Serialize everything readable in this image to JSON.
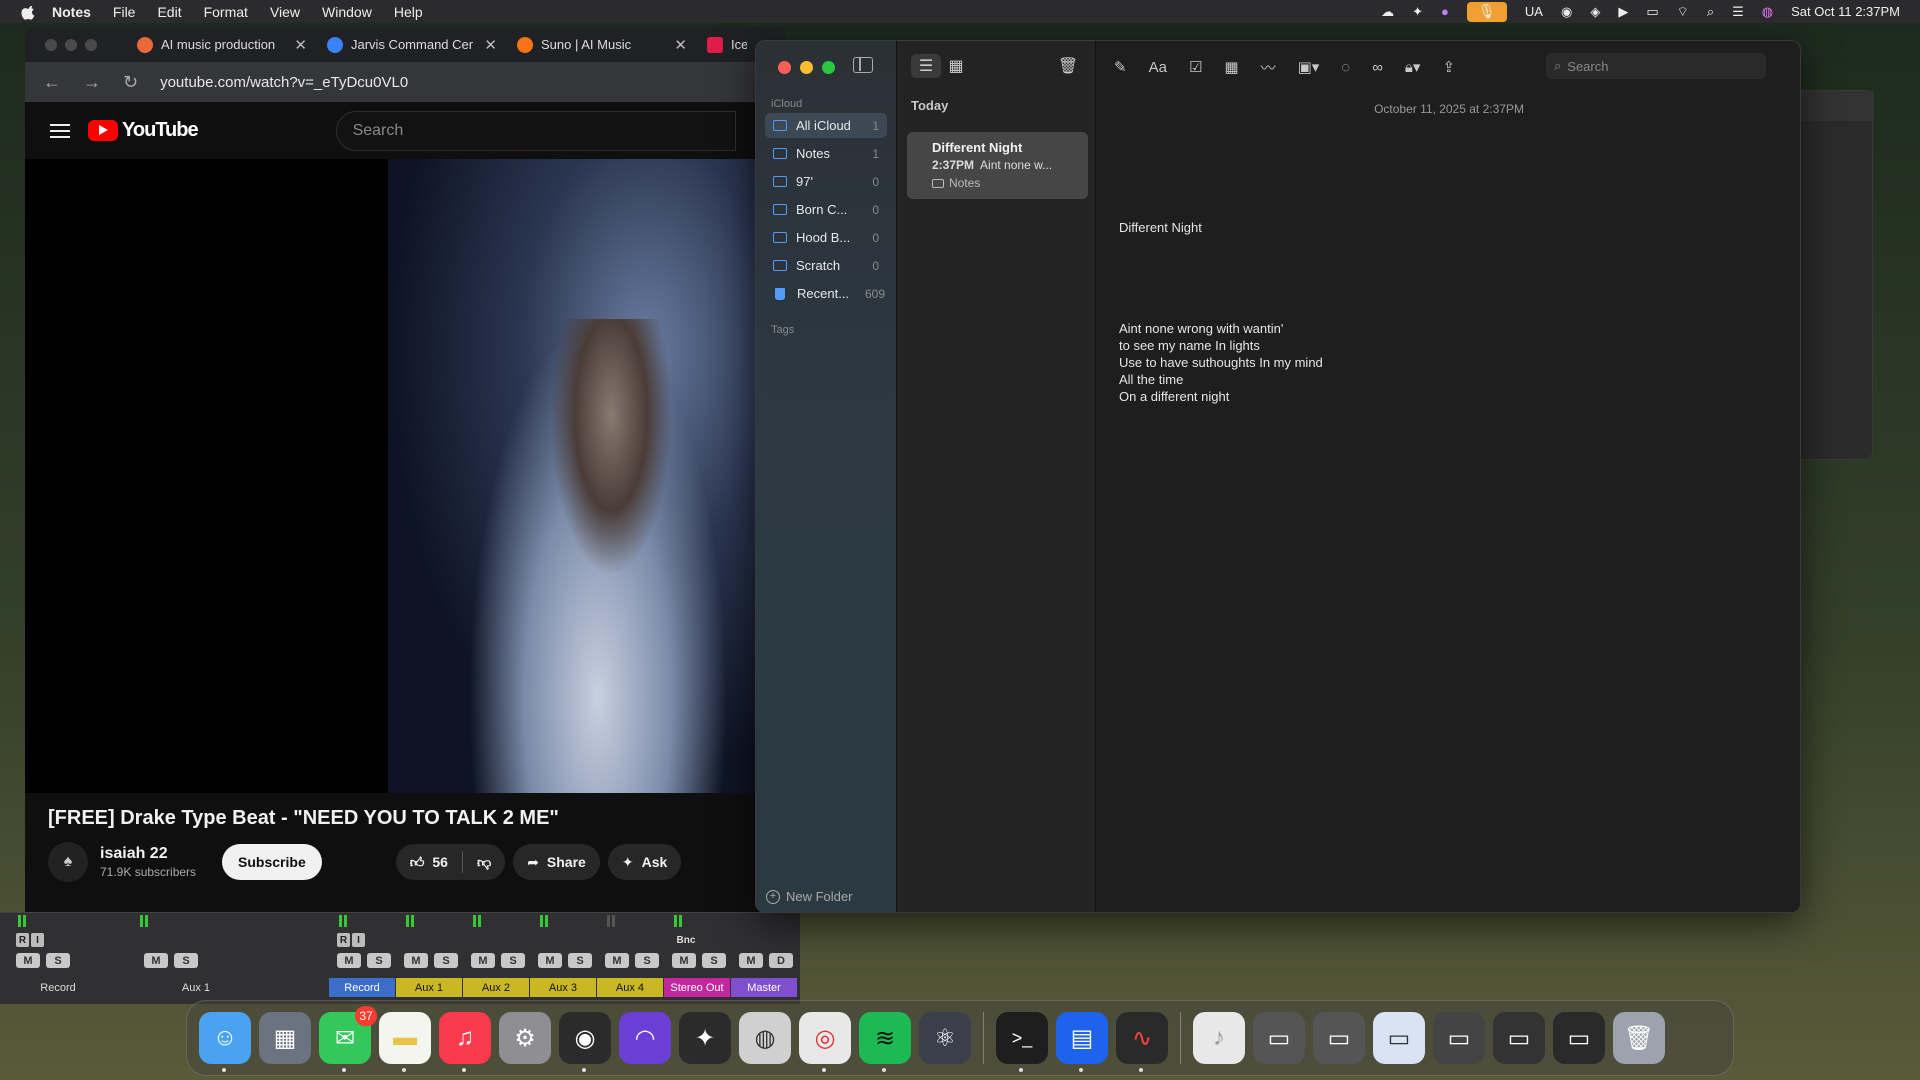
{
  "menubar": {
    "app": "Notes",
    "items": [
      "File",
      "Edit",
      "Format",
      "View",
      "Window",
      "Help"
    ],
    "keyboard_layout": "UA",
    "datetime": "Sat Oct 11  2:37PM"
  },
  "browser": {
    "tabs": [
      {
        "label": "AI music production",
        "favicon_color": "#e86a3a"
      },
      {
        "label": "Jarvis Command Cer",
        "favicon_color": "#3b82f6"
      },
      {
        "label": "Suno | AI Music",
        "favicon_color": "#f97316"
      },
      {
        "label": "Ice",
        "favicon_color": "#e11d48"
      }
    ],
    "url": "youtube.com/watch?v=_eTyDcu0VL0"
  },
  "youtube": {
    "logo_text": "YouTube",
    "search_placeholder": "Search",
    "video_title": "[FREE] Drake Type Beat - \"NEED YOU TO TALK 2 ME\"",
    "channel_name": "isaiah 22",
    "subscribers": "71.9K subscribers",
    "subscribe_label": "Subscribe",
    "likes": "56",
    "share_label": "Share",
    "ask_label": "Ask"
  },
  "mixer": {
    "left_channels": [
      {
        "name": "Record",
        "has_ri": true
      },
      {
        "name": "Aux 1",
        "has_ri": false
      }
    ],
    "channels": [
      {
        "name": "Record",
        "color": "#3a6ec8",
        "has_ri": true,
        "buttons": [
          "M",
          "S"
        ]
      },
      {
        "name": "Aux 1",
        "color": "#c9b823",
        "buttons": [
          "M",
          "S"
        ]
      },
      {
        "name": "Aux 2",
        "color": "#c9b823",
        "buttons": [
          "M",
          "S"
        ]
      },
      {
        "name": "Aux 3",
        "color": "#c9b823",
        "buttons": [
          "M",
          "S"
        ]
      },
      {
        "name": "Aux 4",
        "color": "#c9b823",
        "buttons": [
          "M",
          "S"
        ]
      },
      {
        "name": "Stereo Out",
        "color": "#c3279f",
        "top_label": "Bnc",
        "buttons": [
          "M",
          "S"
        ]
      },
      {
        "name": "Master",
        "color": "#7f4fd0",
        "buttons": [
          "M",
          "D"
        ]
      }
    ]
  },
  "notes": {
    "sidebar": {
      "section_icloud": "iCloud",
      "folders": [
        {
          "label": "All iCloud",
          "count": "1",
          "selected": true
        },
        {
          "label": "Notes",
          "count": "1"
        },
        {
          "label": "97'",
          "count": "0"
        },
        {
          "label": "Born C...",
          "count": "0"
        },
        {
          "label": "Hood B...",
          "count": "0"
        },
        {
          "label": "Scratch",
          "count": "0"
        },
        {
          "label": "Recent...",
          "count": "609",
          "trash": true
        }
      ],
      "section_tags": "Tags",
      "new_folder_label": "New Folder"
    },
    "list": {
      "heading": "Today",
      "note": {
        "title": "Different Night",
        "time": "2:37PM",
        "preview": "Aint none w...",
        "folder": "Notes"
      }
    },
    "editor": {
      "search_placeholder": "Search",
      "date": "October 11, 2025 at 2:37PM",
      "title": "Different Night",
      "lines": [
        "Aint none wrong with wantin'",
        "to see my name In lights",
        "Use to have suthoughts In my mind",
        "All the time",
        "On a different night"
      ]
    }
  },
  "dock": {
    "apps": [
      {
        "name": "Finder",
        "color": "#4aa3f0",
        "glyph": "☺",
        "running": true
      },
      {
        "name": "Launchpad",
        "color": "#6b7280",
        "glyph": "▦"
      },
      {
        "name": "Messages",
        "color": "#34c759",
        "glyph": "✉",
        "badge": "37",
        "running": true
      },
      {
        "name": "Notes",
        "color": "#f5f5f0",
        "glyph": "",
        "running": true
      },
      {
        "name": "Music",
        "color": "#fb3a4d",
        "glyph": "♫",
        "running": true
      },
      {
        "name": "System Settings",
        "color": "#8e8e93",
        "glyph": "⚙"
      },
      {
        "name": "Logic Pro",
        "color": "#2b2b2b",
        "glyph": "◉",
        "running": true
      },
      {
        "name": "Arc",
        "color": "#6b3fd6",
        "glyph": "◠"
      },
      {
        "name": "MainStage",
        "color": "#2b2b2b",
        "glyph": "✦"
      },
      {
        "name": "Compressor",
        "color": "#d0d0d0",
        "glyph": "◍"
      },
      {
        "name": "Chrome",
        "color": "#e8e8e8",
        "glyph": "◎",
        "running": true
      },
      {
        "name": "Spotify",
        "color": "#1db954",
        "glyph": "≋",
        "running": true
      },
      {
        "name": "Atom",
        "color": "#3a3f4b",
        "glyph": "⚛"
      },
      {
        "name": "Terminal",
        "color": "#1e1e1e",
        "glyph": ">_",
        "running": true
      },
      {
        "name": "Docker",
        "color": "#1d63ed",
        "glyph": "▤",
        "running": true
      },
      {
        "name": "Voice Memos",
        "color": "#2a2a2a",
        "glyph": "∿",
        "running": true
      }
    ],
    "stack_items": [
      {
        "name": "Music file",
        "color": "#e8e8e8",
        "glyph": "♪"
      },
      {
        "name": "Window thumbnail 1",
        "color": "#555",
        "glyph": "▭"
      },
      {
        "name": "Window thumbnail 2",
        "color": "#555",
        "glyph": "▭"
      },
      {
        "name": "Window thumbnail 3",
        "color": "#d8e4f4",
        "glyph": "▭"
      },
      {
        "name": "Window thumbnail 4",
        "color": "#444",
        "glyph": "▭"
      },
      {
        "name": "Window thumbnail 5",
        "color": "#333",
        "glyph": "▭"
      },
      {
        "name": "Window thumbnail 6",
        "color": "#2a2a2a",
        "glyph": "▭"
      },
      {
        "name": "Trash",
        "color": "#9ca3af",
        "glyph": "🗑"
      }
    ]
  },
  "colors": {
    "notes_accent": "#4f9cf9",
    "youtube_red": "#ff0000",
    "traffic_close": "#ff5f57",
    "traffic_min": "#febc2e",
    "traffic_max": "#28c840"
  }
}
